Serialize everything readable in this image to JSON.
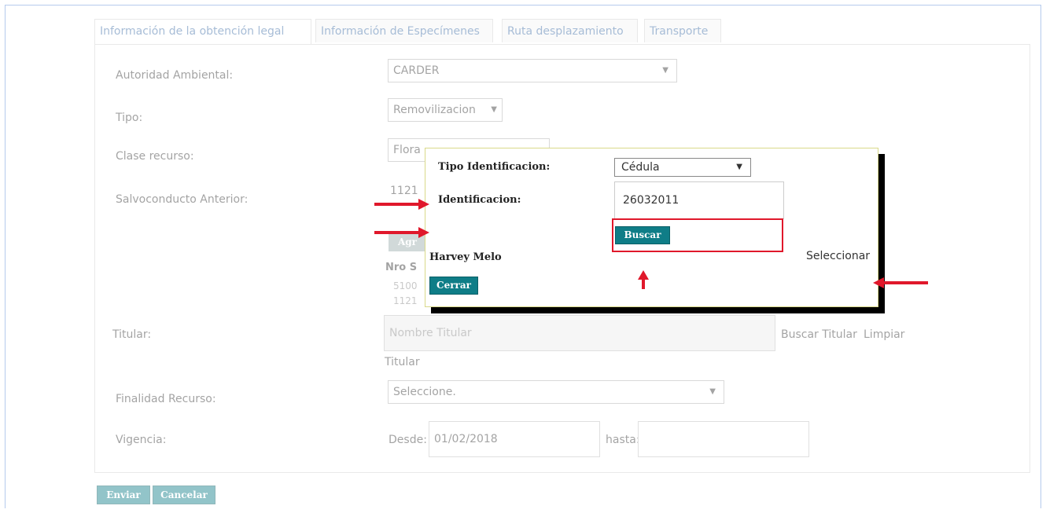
{
  "tabs": [
    {
      "label": "Información de la obtención legal"
    },
    {
      "label": "Información de Especímenes"
    },
    {
      "label": "Ruta desplazamiento"
    },
    {
      "label": "Transporte"
    }
  ],
  "form": {
    "autoridad_label": "Autoridad Ambiental:",
    "autoridad_value": "CARDER",
    "tipo_label": "Tipo:",
    "tipo_value": "Removilizacion",
    "clase_label": "Clase recurso:",
    "clase_value": "Flora",
    "salvoconducto_label": "Salvoconducto Anterior:",
    "salvoconducto_value": "1121",
    "agregar_label": "Agr",
    "nro_label": "Nro S",
    "nro_row1": "5100",
    "nro_row2": "1121",
    "titular_label": "Titular:",
    "titular_placeholder": "Nombre Titular",
    "buscar_titular": "Buscar Titular",
    "limpiar_titular_1": "Limpiar",
    "limpiar_titular_2": "Titular",
    "finalidad_label": "Finalidad Recurso:",
    "finalidad_value": "Seleccione.",
    "vigencia_label": "Vigencia:",
    "desde_label": "Desde:",
    "desde_value": "01/02/2018",
    "hasta_label": "hasta:",
    "hasta_value": ""
  },
  "actions": {
    "enviar": "Enviar",
    "cancelar": "Cancelar"
  },
  "modal": {
    "tipo_id_label": "Tipo Identificacion:",
    "tipo_id_value": "Cédula",
    "id_label": "Identificacion:",
    "id_value": "26032011",
    "buscar": "Buscar",
    "result_name": "Harvey Melo",
    "seleccionar": "Seleccionar",
    "cerrar": "Cerrar"
  },
  "colors": {
    "teal_button": "#0f7d87",
    "annotation_red": "#e0182b",
    "tab_text": "#3a6aa5"
  }
}
